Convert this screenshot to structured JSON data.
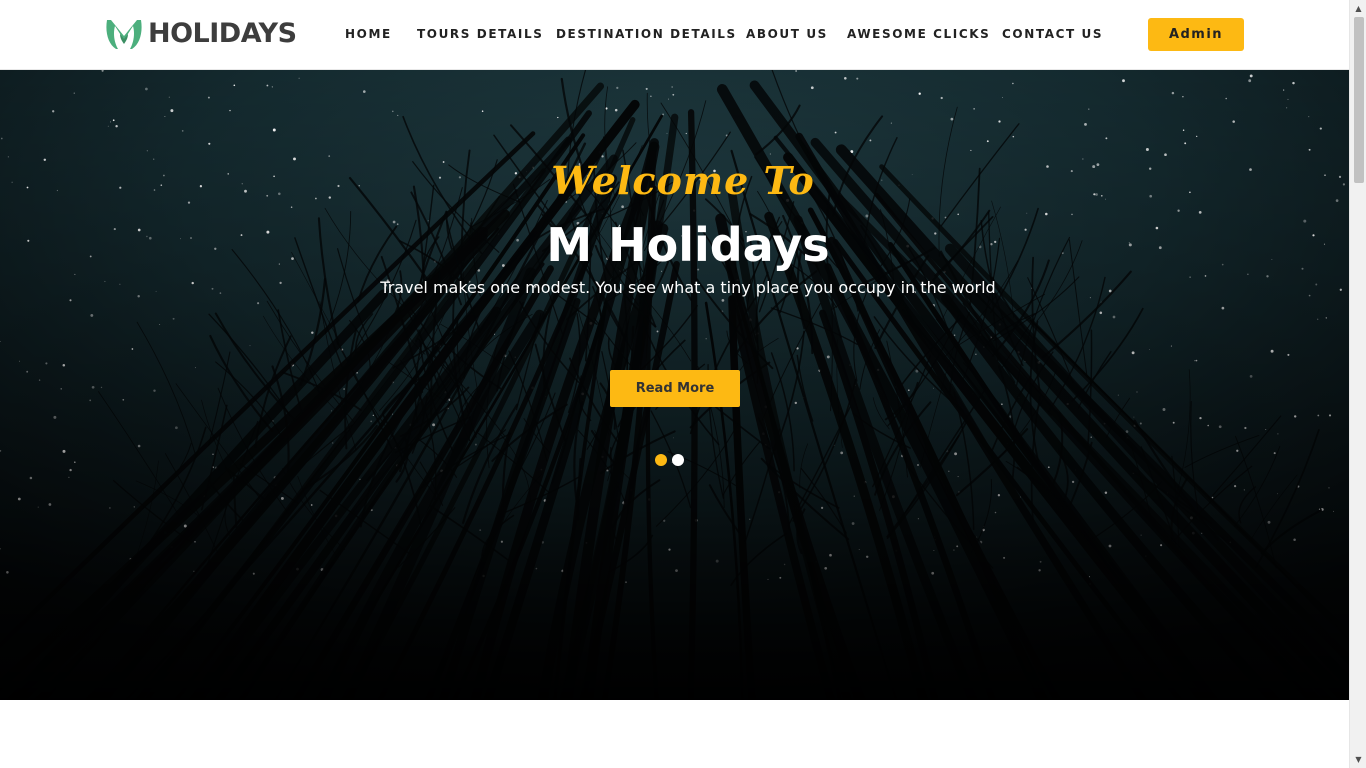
{
  "brand": {
    "logo_text": "HOLIDAYS",
    "logo_icon": "m-leaf-logo-icon",
    "logo_color": "#4caf7d"
  },
  "nav": {
    "items": [
      {
        "label": "HOME"
      },
      {
        "label": "TOURS DETAILS"
      },
      {
        "label": "DESTINATION DETAILS"
      },
      {
        "label": "ABOUT US"
      },
      {
        "label": "AWESOME CLICKS"
      },
      {
        "label": "CONTACT US"
      }
    ],
    "admin_label": "Admin"
  },
  "hero": {
    "welcome": "Welcome To",
    "title": "M Holidays",
    "tagline": "Travel makes one modest. You see what a tiny place you occupy in the world",
    "button_label": "Read More",
    "slides": 2,
    "active_slide": 1,
    "background": "starry-night-forest-image"
  },
  "colors": {
    "accent": "#fdb913",
    "header_bg": "#ffffff",
    "nav_text": "#222222",
    "hero_text": "#ffffff"
  }
}
